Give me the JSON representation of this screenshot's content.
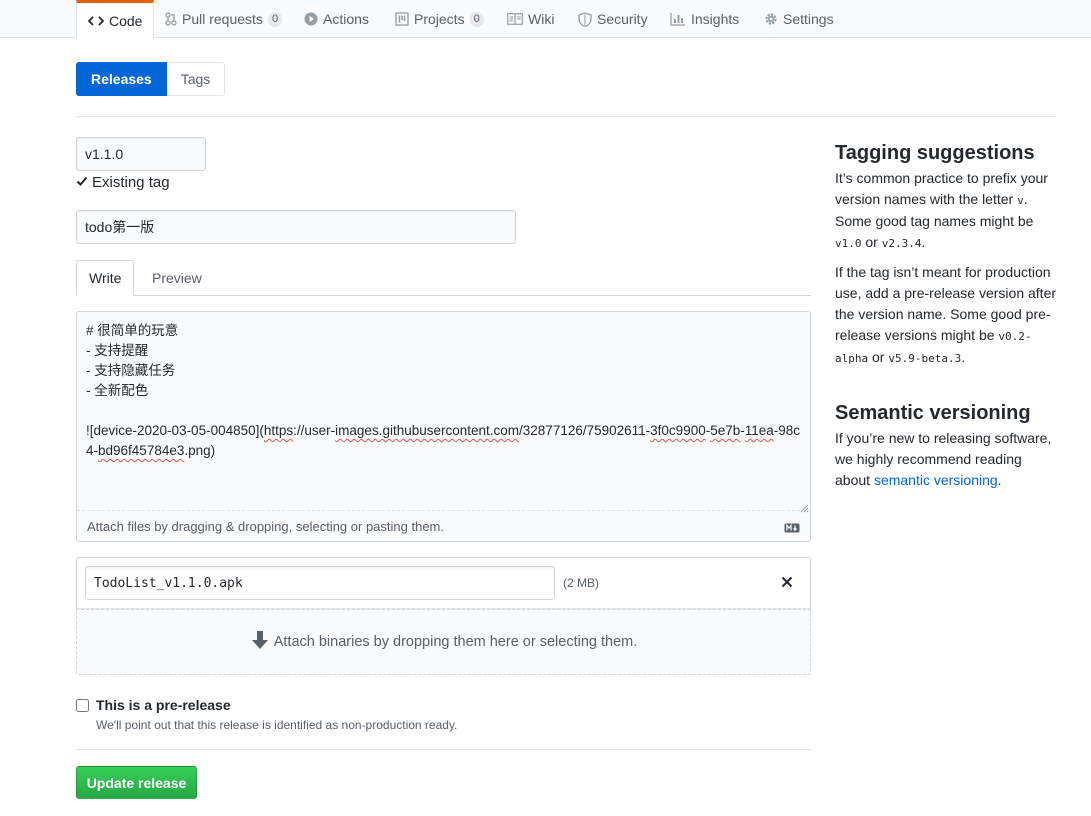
{
  "repo_nav": {
    "tabs": [
      {
        "label": "Code",
        "icon": "code-icon",
        "selected": true
      },
      {
        "label": "Pull requests",
        "icon": "pull-request-icon",
        "count": "0"
      },
      {
        "label": "Actions",
        "icon": "play-icon"
      },
      {
        "label": "Projects",
        "icon": "project-icon",
        "count": "0"
      },
      {
        "label": "Wiki",
        "icon": "book-icon"
      },
      {
        "label": "Security",
        "icon": "shield-icon"
      },
      {
        "label": "Insights",
        "icon": "graph-icon"
      },
      {
        "label": "Settings",
        "icon": "gear-icon"
      }
    ]
  },
  "subnav": {
    "releases": "Releases",
    "tags": "Tags"
  },
  "form": {
    "tag_value": "v1.1.0",
    "tag_status": "Existing tag",
    "title_value": "todo第一版",
    "tabs": {
      "write": "Write",
      "preview": "Preview"
    },
    "body_lines": [
      "# 很简单的玩意",
      "- 支持提醒",
      "- 支持隐藏任务",
      "- 全新配色"
    ],
    "body_image_link": {
      "prefix": "![device-2020-03-05-004850](",
      "p1": "https",
      "p2": "://user-",
      "p3": "images.githubusercontent.com",
      "p4": "/32877126/75902611-",
      "p5": "3f0c9900",
      "p6": "-",
      "p7": "5e7b",
      "p8": "-",
      "p9": "11ea",
      "p10": "-98c4-",
      "p11": "bd96f45784e3",
      "p12": ".png)"
    },
    "attach_hint": "Attach files by dragging & dropping, selecting or pasting them."
  },
  "assets": {
    "file_name": "TodoList_v1.1.0.apk",
    "file_size": "(2 MB)",
    "drop_hint": "Attach binaries by dropping them here or selecting them."
  },
  "prerelease": {
    "label": "This is a pre-release",
    "note": "We'll point out that this release is identified as non-production ready.",
    "checked": false
  },
  "submit_label": "Update release",
  "sidebar": {
    "tagging_title": "Tagging suggestions",
    "tagging_p1_a": "It’s common practice to prefix your version names with the letter ",
    "tagging_p1_code": "v",
    "tagging_p1_b": ". Some good tag names might be ",
    "tagging_p1_code2": "v1.0",
    "tagging_p1_c": " or ",
    "tagging_p1_code3": "v2.3.4",
    "tagging_p1_d": ".",
    "tagging_p2_a": "If the tag isn’t meant for production use, add a pre-release version after the version name. Some good pre-release versions might be ",
    "tagging_p2_code": "v0.2-alpha",
    "tagging_p2_b": " or ",
    "tagging_p2_code2": "v5.9-beta.3",
    "tagging_p2_c": ".",
    "semver_title": "Semantic versioning",
    "semver_p_a": "If you’re new to releasing software, we highly recommend reading about ",
    "semver_link": "semantic versioning",
    "semver_p_b": "."
  }
}
